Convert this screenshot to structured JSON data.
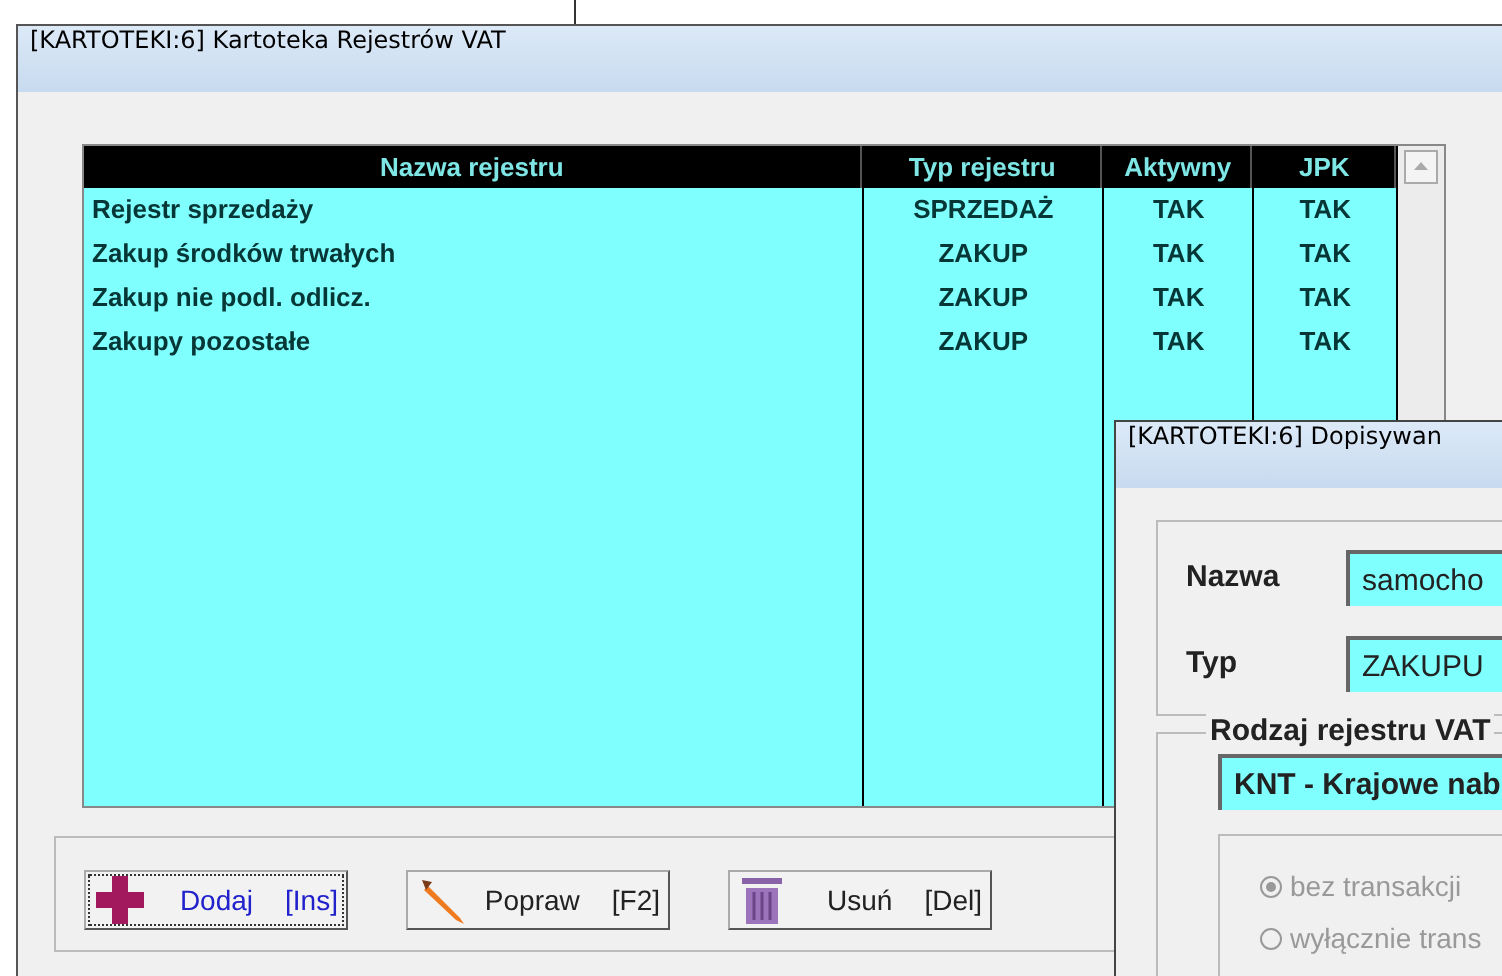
{
  "main_window": {
    "title": "[KARTOTEKI:6]  Kartoteka Rejestrów VAT",
    "table": {
      "columns": [
        {
          "label": "Nazwa rejestru"
        },
        {
          "label": "Typ rejestru"
        },
        {
          "label": "Aktywny"
        },
        {
          "label": "JPK"
        }
      ],
      "rows": [
        {
          "cells": [
            "Rejestr sprzedaży",
            "SPRZEDAŻ",
            "TAK",
            "TAK"
          ]
        },
        {
          "cells": [
            "Zakup środków trwałych",
            "ZAKUP",
            "TAK",
            "TAK"
          ]
        },
        {
          "cells": [
            "Zakup nie podl. odlicz.",
            "ZAKUP",
            "TAK",
            "TAK"
          ]
        },
        {
          "cells": [
            "Zakupy pozostałe",
            "ZAKUP",
            "TAK",
            "TAK"
          ]
        }
      ]
    },
    "buttons": [
      {
        "kind": "add",
        "label": "Dodaj",
        "shortcut": "[Ins]",
        "focused": true
      },
      {
        "kind": "edit",
        "label": "Popraw",
        "shortcut": "[F2]",
        "focused": false
      },
      {
        "kind": "delete",
        "label": "Usuń",
        "shortcut": "[Del]",
        "focused": false
      }
    ]
  },
  "dialog": {
    "title": "[KARTOTEKI:6]  Dopisywan",
    "fields": [
      {
        "label": "Nazwa",
        "value": "samocho"
      },
      {
        "label": "Typ",
        "value": "ZAKUPU"
      }
    ],
    "group": {
      "legend": "Rodzaj rejestru VAT",
      "value": "KNT - Krajowe nab",
      "radios": [
        {
          "label": "bez transakcji",
          "selected": true,
          "disabled": true
        },
        {
          "label": "wyłącznie trans",
          "selected": false,
          "disabled": true
        }
      ]
    }
  }
}
